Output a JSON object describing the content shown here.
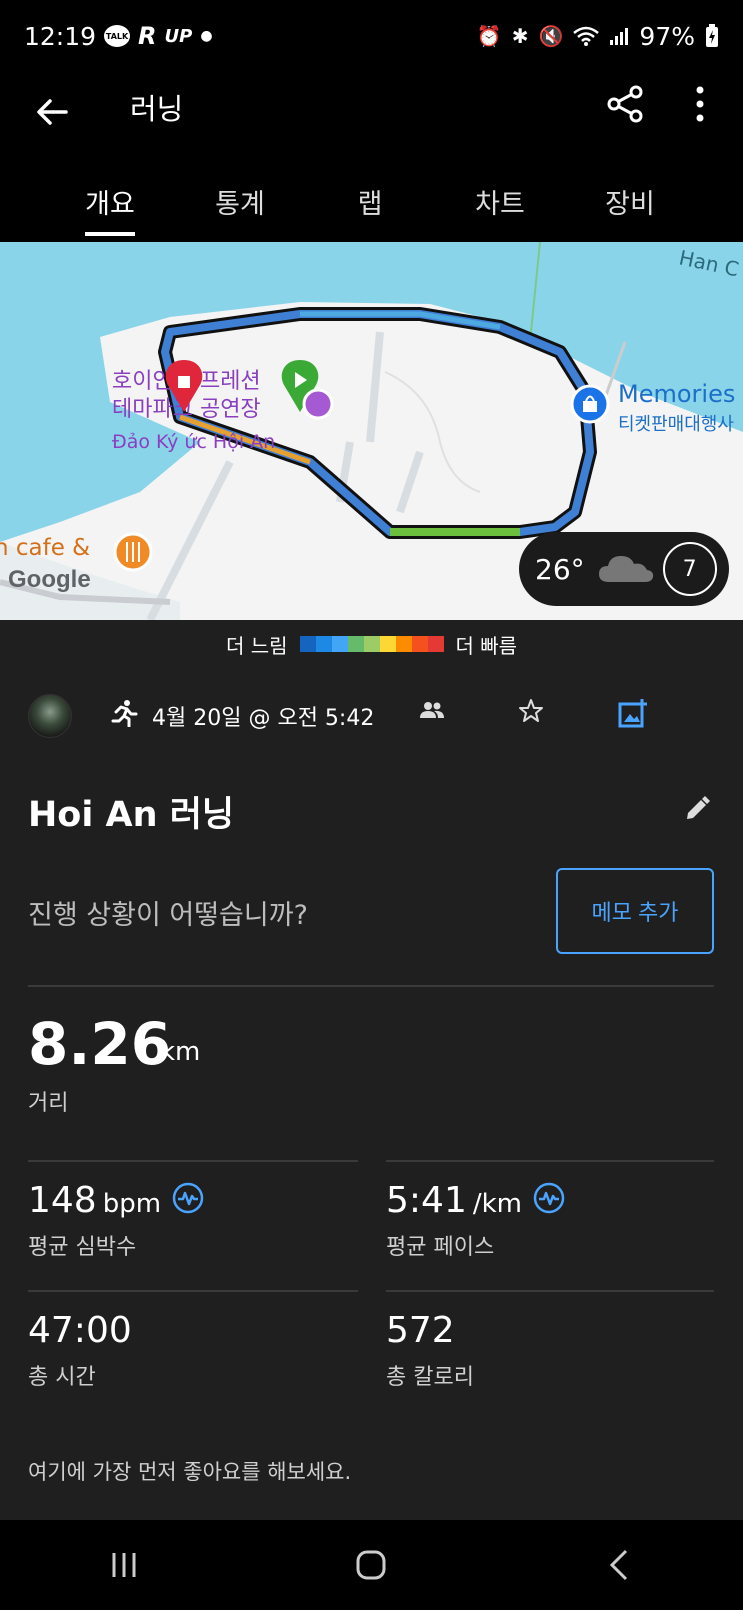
{
  "status": {
    "time": "12:19",
    "talk_badge": "TALK",
    "r_icon": "R",
    "up_icon": "UP",
    "battery": "97%"
  },
  "appbar": {
    "title": "러닝"
  },
  "tabs": [
    {
      "label": "개요"
    },
    {
      "label": "통계"
    },
    {
      "label": "랩"
    },
    {
      "label": "차트"
    },
    {
      "label": "장비"
    }
  ],
  "map": {
    "labels": {
      "park_ko_1": "호이안 임프레션",
      "park_ko_2": "테마파크 공연장",
      "park_vi": "Đảo Ký ức Hội An",
      "memories": "Memories",
      "ticket": "티켓판매대행사",
      "cafe": "h cafe &",
      "google": "Google",
      "corner": "Han C"
    },
    "weather": {
      "temp": "26°",
      "wind": "7"
    }
  },
  "legend": {
    "slow": "더 느림",
    "fast": "더 빠름",
    "colors": [
      "#1565c0",
      "#1e88e5",
      "#42a5f5",
      "#66bb6a",
      "#9ccc65",
      "#fdd835",
      "#fb8c00",
      "#f4511e",
      "#e53935"
    ]
  },
  "activity": {
    "date": "4월 20일 @ 오전 5:42",
    "title": "Hoi An 러닝",
    "prompt": "진행 상황이 어떻습니까?",
    "memo_button": "메모 추가",
    "distance": {
      "value": "8.26",
      "unit": "km",
      "label": "거리"
    },
    "heart_rate": {
      "value": "148",
      "unit": "bpm",
      "label": "평균 심박수"
    },
    "pace": {
      "value": "5:41",
      "unit": "/km",
      "label": "평균 페이스"
    },
    "time": {
      "value": "47:00",
      "label": "총 시간"
    },
    "calories": {
      "value": "572",
      "label": "총 칼로리"
    },
    "like_prompt": "여기에 가장 먼저 좋아요를 해보세요."
  }
}
